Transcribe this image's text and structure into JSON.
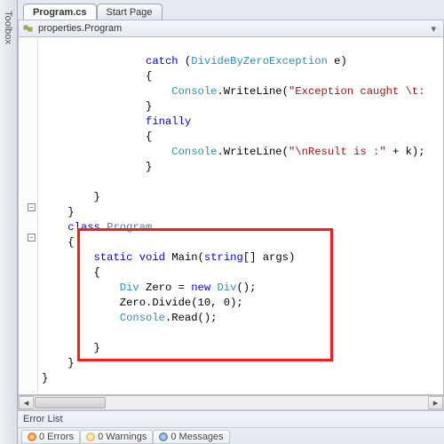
{
  "toolbox": {
    "label": "Toolbox"
  },
  "tabs": {
    "active": "Program.cs",
    "inactive": "Start Page"
  },
  "nav": {
    "scope": "properties.Program"
  },
  "code": {
    "l1_kw": "catch",
    "l1_rest": " (",
    "l1_type": "DivideByZeroException",
    "l1_rest2": " e)",
    "l2": "{",
    "l3_type": "Console",
    "l3_rest": ".WriteLine(",
    "l3_str": "\"Exception caught \\t:",
    "l4": "}",
    "l5_kw": "finally",
    "l6": "{",
    "l7_type": "Console",
    "l7_rest": ".WriteLine(",
    "l7_str": "\"\\nResult is :\"",
    "l7_rest2": " + k);",
    "l8": "}",
    "l10": "}",
    "l11": "}",
    "l12_kw": "class",
    "l12_type": "Program",
    "l13": "{",
    "l14_kw1": "static",
    "l14_kw2": "void",
    "l14_name": " Main(",
    "l14_kw3": "string",
    "l14_rest": "[] args)",
    "l15": "{",
    "l16_type": "Div",
    "l16_rest": " Zero = ",
    "l16_kw": "new",
    "l16_type2": "Div",
    "l16_rest2": "();",
    "l17_rest": "Zero.Divide(10, 0);",
    "l18_type": "Console",
    "l18_rest": ".Read();",
    "l20": "}",
    "l21": "}",
    "l22": "}"
  },
  "errorList": {
    "title": "Error List",
    "errors": "0 Errors",
    "warnings": "0 Warnings",
    "messages": "0 Messages"
  }
}
